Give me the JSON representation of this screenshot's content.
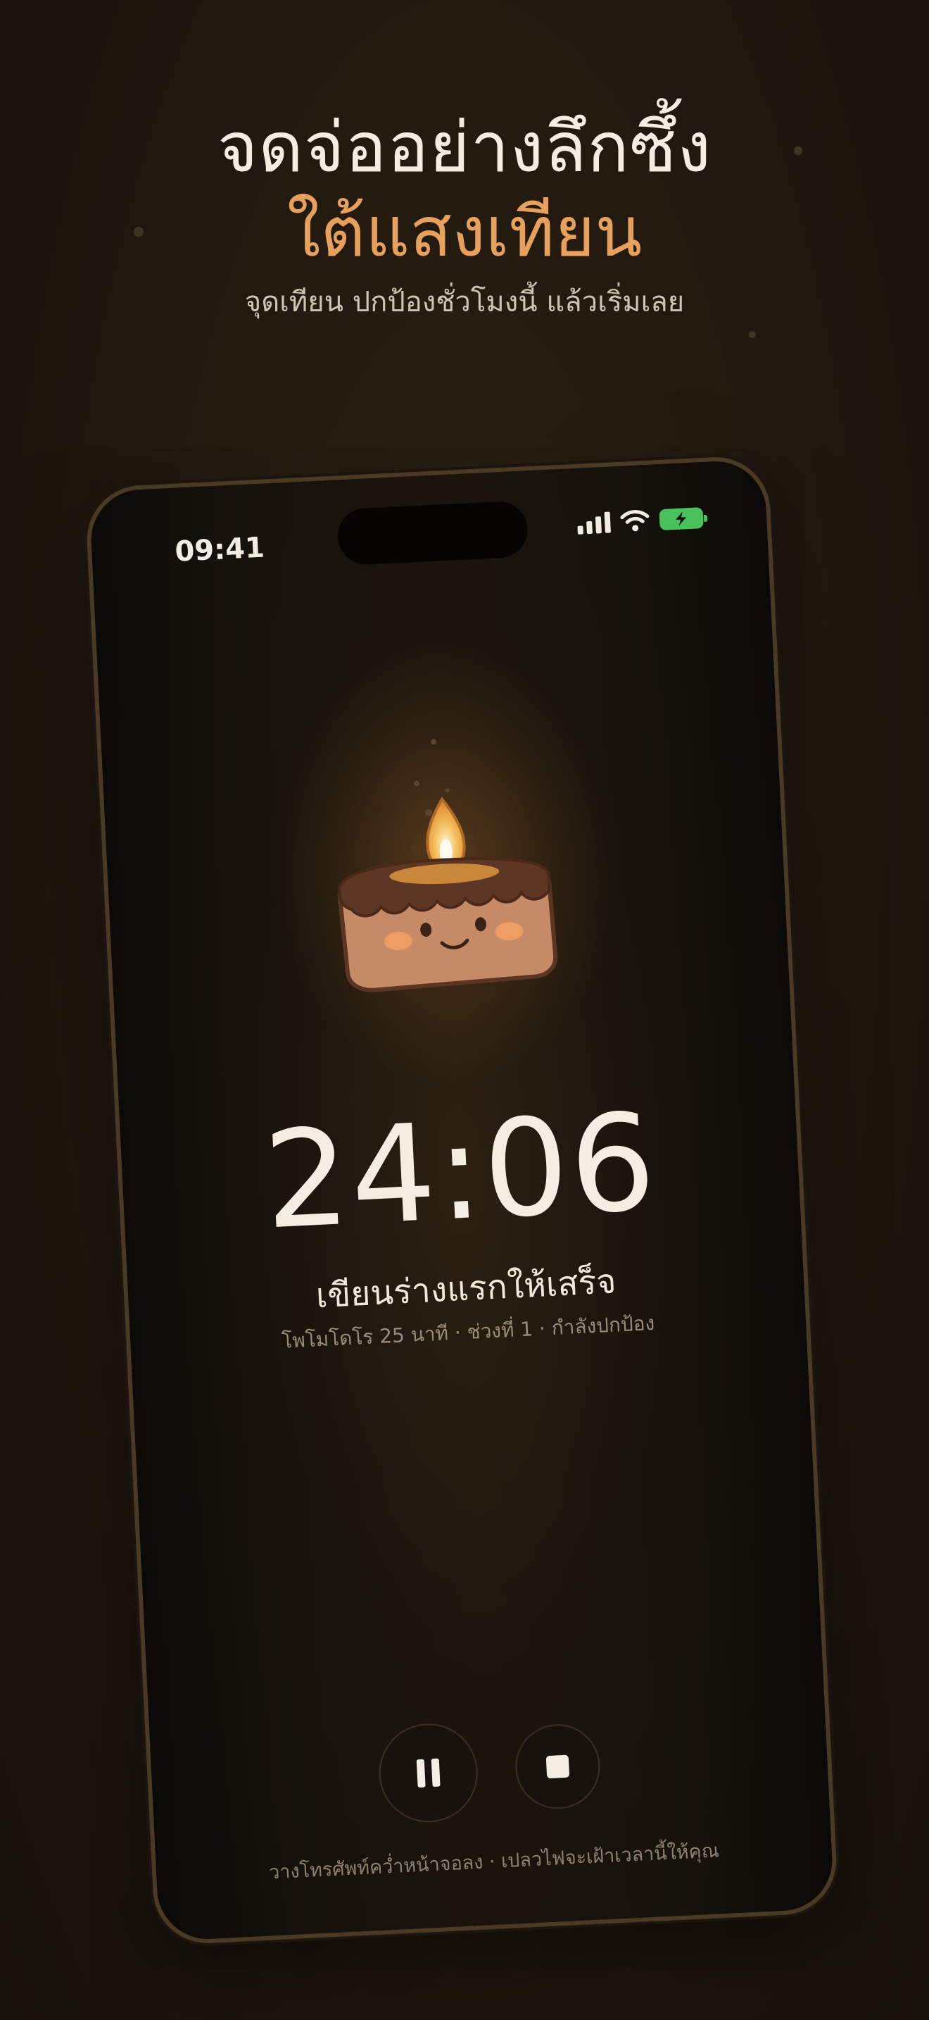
{
  "promo": {
    "headline_line1": "จดจ่ออย่างลึกซึ้ง",
    "headline_line2": "ใต้แสงเทียน",
    "subheadline": "จุดเทียน ปกป้องชั่วโมงนี้ แล้วเริ่มเลย",
    "accent_color": "#e7a15c"
  },
  "status_bar": {
    "time": "09:41",
    "signal_icon": "cellular-bars-icon",
    "wifi_icon": "wifi-icon",
    "battery_icon": "battery-charging-icon",
    "battery_color": "#4cc45e"
  },
  "focus": {
    "mascot_icon": "candle-cake-mascot",
    "timer": "24:06",
    "task": "เขียนร่างแรกให้เสร็จ",
    "meta": "โพโมโดโร 25 นาที · ช่วงที่ 1 · กำลังปกป้อง"
  },
  "controls": {
    "pause_icon": "pause-icon",
    "stop_icon": "stop-icon"
  },
  "hint": "วางโทรศัพท์คว่ำหน้าจอลง · เปลวไฟจะเฝ้าเวลานี้ให้คุณ"
}
